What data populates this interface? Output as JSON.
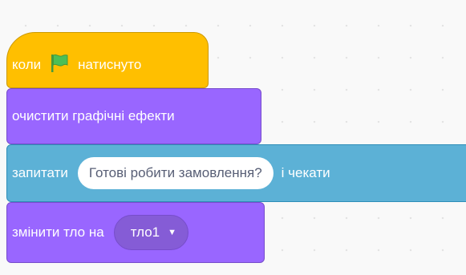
{
  "blocks": {
    "when_flag": {
      "before": "коли",
      "icon": "green-flag-icon",
      "after": "натиснуто"
    },
    "clear_effects": {
      "label": "очистити графічні ефекти"
    },
    "ask_and_wait": {
      "label": "запитати",
      "input": "Готові робити замовлення?",
      "suffix": "і чекати"
    },
    "switch_backdrop": {
      "label": "змінити тло на",
      "value": "тло1"
    }
  },
  "colors": {
    "events": "#FFBF00",
    "looks": "#9966FF",
    "sensing": "#5CB1D6",
    "flag": "#4CBF56"
  }
}
